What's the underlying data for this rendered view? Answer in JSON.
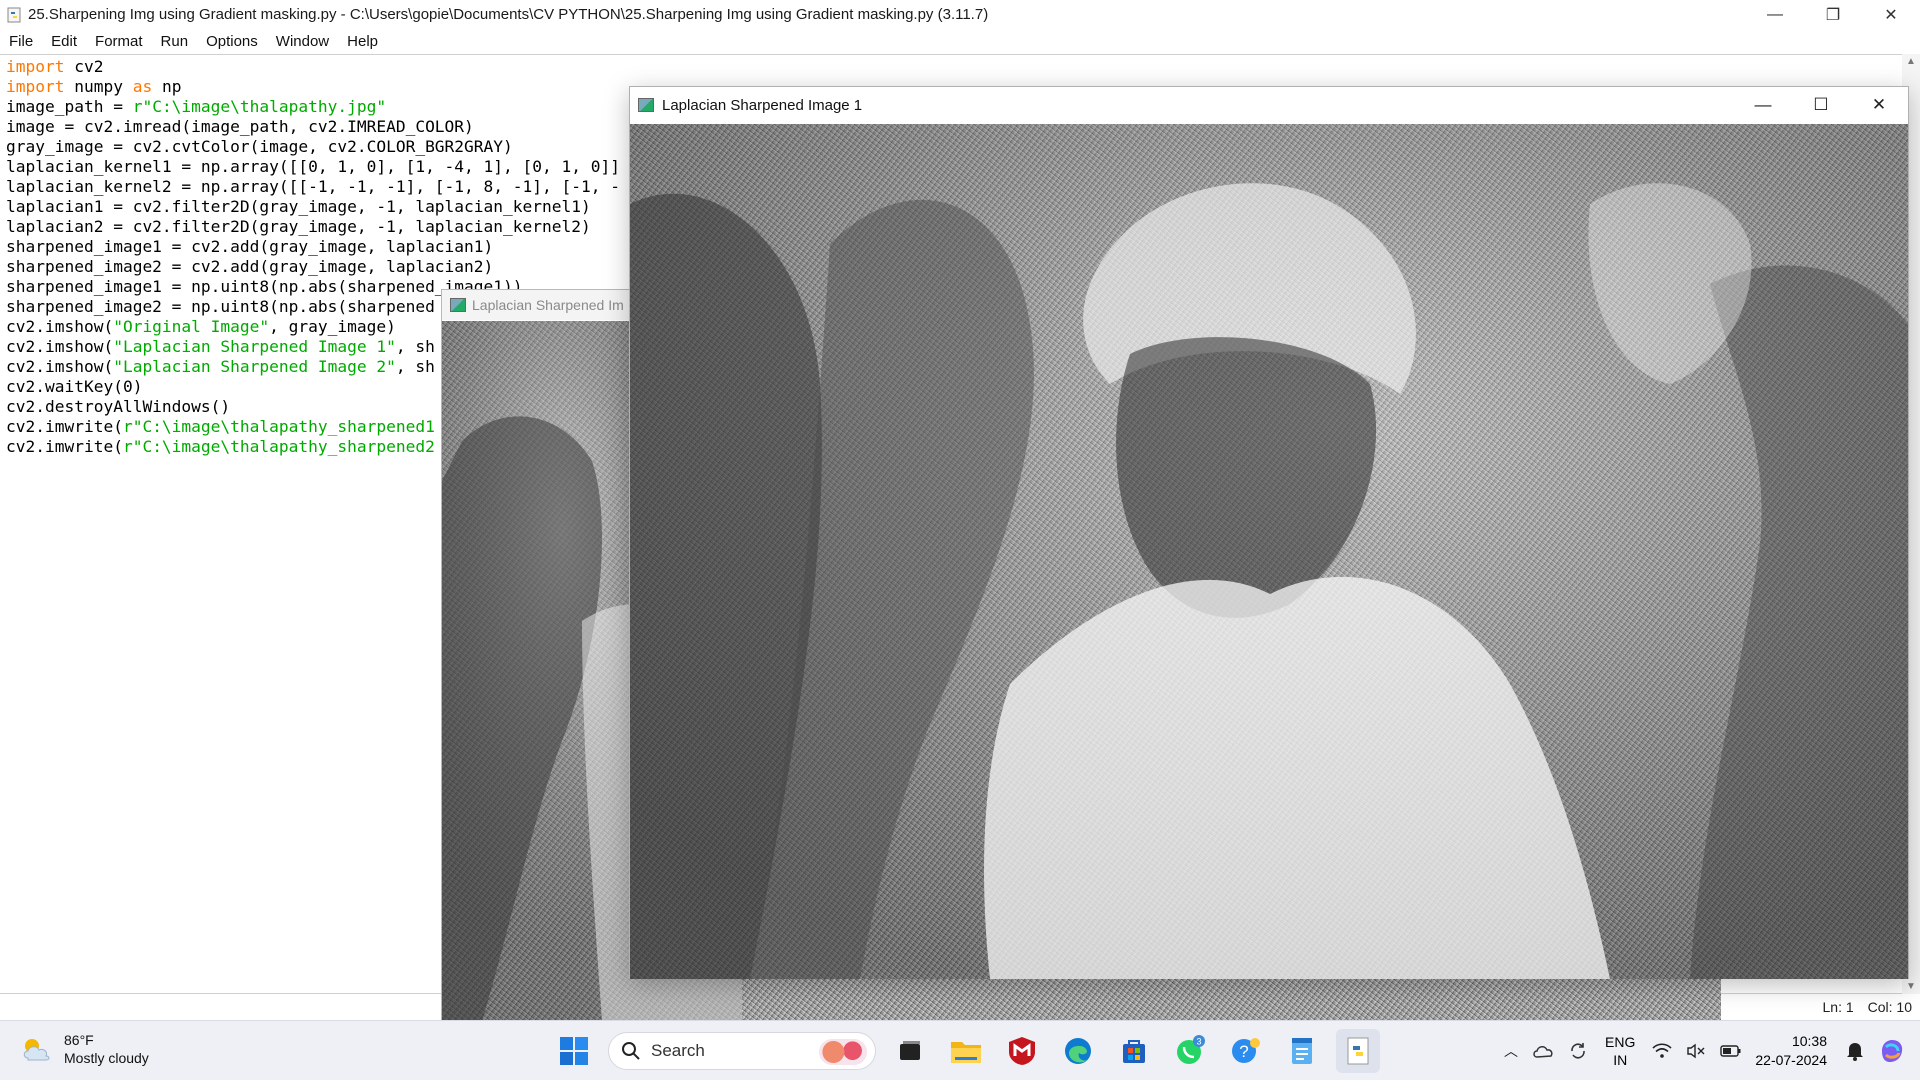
{
  "idle": {
    "title": "25.Sharpening Img using Gradient masking.py - C:\\Users\\gopie\\Documents\\CV PYTHON\\25.Sharpening Img using Gradient masking.py (3.11.7)",
    "menu": [
      "File",
      "Edit",
      "Format",
      "Run",
      "Options",
      "Window",
      "Help"
    ],
    "status": {
      "ln": "Ln: 1",
      "col": "Col: 10"
    },
    "code_lines": [
      "import cv2",
      "import numpy as np",
      "image_path = r\"C:\\image\\thalapathy.jpg\"",
      "image = cv2.imread(image_path, cv2.IMREAD_COLOR)",
      "gray_image = cv2.cvtColor(image, cv2.COLOR_BGR2GRAY)",
      "laplacian_kernel1 = np.array([[0, 1, 0], [1, -4, 1], [0, 1, 0]]",
      "laplacian_kernel2 = np.array([[-1, -1, -1], [-1, 8, -1], [-1, -",
      "laplacian1 = cv2.filter2D(gray_image, -1, laplacian_kernel1)",
      "laplacian2 = cv2.filter2D(gray_image, -1, laplacian_kernel2)",
      "sharpened_image1 = cv2.add(gray_image, laplacian1)",
      "sharpened_image2 = cv2.add(gray_image, laplacian2)",
      "sharpened_image1 = np.uint8(np.abs(sharpened_image1))",
      "sharpened_image2 = np.uint8(np.abs(sharpened",
      "cv2.imshow(\"Original Image\", gray_image)",
      "cv2.imshow(\"Laplacian Sharpened Image 1\", sh",
      "cv2.imshow(\"Laplacian Sharpened Image 2\", sh",
      "cv2.waitKey(0)",
      "cv2.destroyAllWindows()",
      "cv2.imwrite(r\"C:\\image\\thalapathy_sharpened1",
      "cv2.imwrite(r\"C:\\image\\thalapathy_sharpened2"
    ]
  },
  "window1": {
    "title": "Laplacian Sharpened Image 1"
  },
  "window2": {
    "title": "Laplacian Sharpened Im"
  },
  "taskbar": {
    "weather_temp": "86°F",
    "weather_desc": "Mostly cloudy",
    "search_placeholder": "Search",
    "lang_top": "ENG",
    "lang_bottom": "IN",
    "time": "10:38",
    "date": "22-07-2024",
    "whatsapp_badge": "3",
    "apps": [
      "task-view",
      "file-explorer",
      "mcafee",
      "edge",
      "microsoft-store",
      "whatsapp",
      "tips",
      "notepad",
      "idle-python"
    ]
  },
  "colors": {
    "keyword": "#ff7700",
    "string": "#00aa00",
    "taskbar": "#eef0f5"
  }
}
